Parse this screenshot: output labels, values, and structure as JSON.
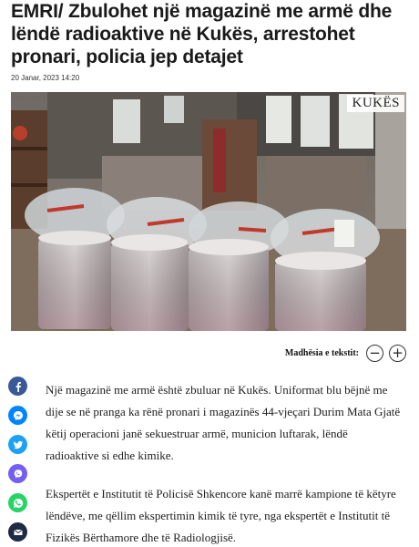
{
  "article": {
    "headline": "EMRI/ Zbulohet një magazinë me armë dhe lëndë radioaktive në Kukës, arrestohet pronari, policia jep detajet",
    "date": "20 Janar, 2023 14:20",
    "photo_caption": "KUKËS",
    "paragraphs": [
      "Një magazinë me armë është zbuluar në Kukës. Uniformat blu bëjnë me dije se në pranga ka rënë pronari i magazinës 44-vjeçari Durim Mata Gjatë këtij operacioni janë sekuestruar armë, municion luftarak, lëndë radioaktive si edhe kimike.",
      "Ekspertët e Institutit të Policisë Shkencore kanë marrë kampione të këtyre lëndëve, me qëllim ekspertimin kimik të tyre, nga ekspertët e Institutit të Fizikës Bërthamore dhe të Radiologjisë."
    ]
  },
  "font_size_control": {
    "label": "Madhësia e tekstit:",
    "decrease_glyph": "−",
    "increase_glyph": "+"
  },
  "share_buttons": [
    {
      "name": "facebook",
      "icon": "facebook-icon",
      "color": "#3b5998"
    },
    {
      "name": "messenger",
      "icon": "messenger-icon",
      "color": "#0084ff"
    },
    {
      "name": "twitter",
      "icon": "twitter-icon",
      "color": "#1da1f2"
    },
    {
      "name": "viber",
      "icon": "viber-icon",
      "color": "#7360f2"
    },
    {
      "name": "whatsapp",
      "icon": "whatsapp-icon",
      "color": "#25d366"
    },
    {
      "name": "email",
      "icon": "email-icon",
      "color": "#1f2a44"
    }
  ]
}
